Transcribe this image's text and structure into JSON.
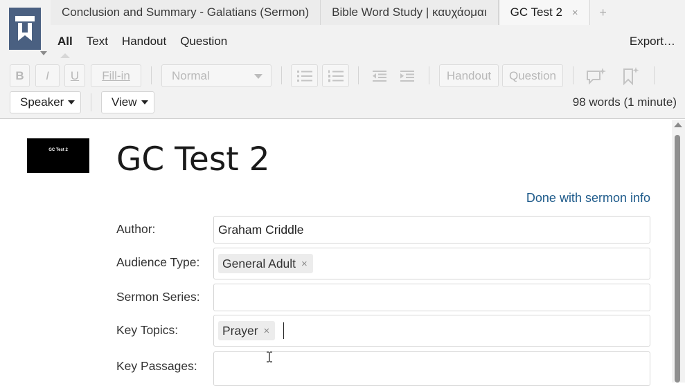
{
  "tabs": [
    {
      "label": "Conclusion and Summary - Galatians (Sermon)"
    },
    {
      "label": "Bible Word Study | καυχάομαι"
    },
    {
      "label": "GC Test 2",
      "close": "×"
    }
  ],
  "tab_add": "+",
  "filters": [
    "All",
    "Text",
    "Handout",
    "Question"
  ],
  "export_label": "Export…",
  "toolbar": {
    "bold": "B",
    "italic": "I",
    "underline": "U",
    "fill_in": "Fill-in",
    "style_value": "Normal",
    "handout": "Handout",
    "question": "Question"
  },
  "row3": {
    "speaker": "Speaker",
    "view": "View",
    "word_count": "98 words (1 minute)"
  },
  "thumbnail_text": "GC Test 2",
  "doc_title": "GC Test 2",
  "done_link": "Done with sermon info",
  "fields": {
    "author_label": "Author:",
    "author_value": "Graham Criddle",
    "audience_label": "Audience Type:",
    "audience_chip": "General Adult",
    "series_label": "Sermon Series:",
    "series_value": "",
    "topics_label": "Key Topics:",
    "topics_chip": "Prayer",
    "passages_label": "Key Passages:",
    "passages_value": "",
    "chip_remove": "×"
  }
}
